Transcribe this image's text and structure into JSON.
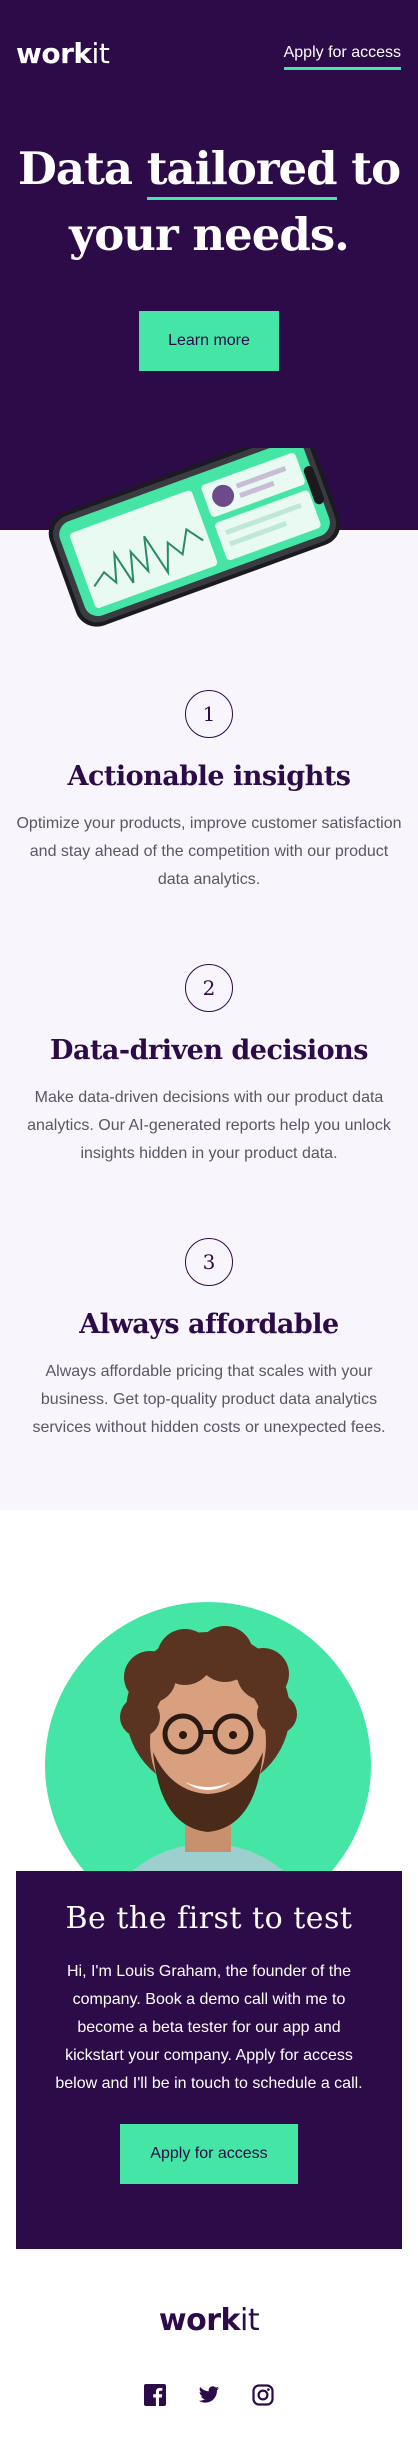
{
  "header": {
    "logo_bold": "work",
    "logo_light": "it",
    "nav_cta": "Apply for access"
  },
  "hero": {
    "title_part1": "Data ",
    "title_highlight": "tailored",
    "title_part2": " to",
    "title_line2": "your needs.",
    "button": "Learn more"
  },
  "features": [
    {
      "number": "1",
      "title": "Actionable insights",
      "text": "Optimize your products, improve customer satisfaction and stay ahead of the competition with our product data analytics."
    },
    {
      "number": "2",
      "title": "Data-driven decisions",
      "text": "Make data-driven decisions with our product data analytics. Our AI-generated reports help you unlock insights hidden in your product data."
    },
    {
      "number": "3",
      "title": "Always affordable",
      "text": "Always affordable pricing that scales with your business. Get top-quality product data analytics services without hidden costs or unexpected fees."
    }
  ],
  "founder": {
    "title": "Be the first to test",
    "text": "Hi, I'm Louis Graham, the founder of the company. Book a demo call with me to become a beta tester for our app and kickstart your company. Apply for access below and I'll be in touch to schedule a call.",
    "button": "Apply for access"
  },
  "footer": {
    "logo_bold": "work",
    "logo_light": "it",
    "social_icons": [
      "facebook-icon",
      "twitter-icon",
      "instagram-icon"
    ]
  },
  "colors": {
    "primary_dark": "#2c0b48",
    "accent_green": "#45e6a5",
    "light_bg": "#f8f5fc"
  }
}
